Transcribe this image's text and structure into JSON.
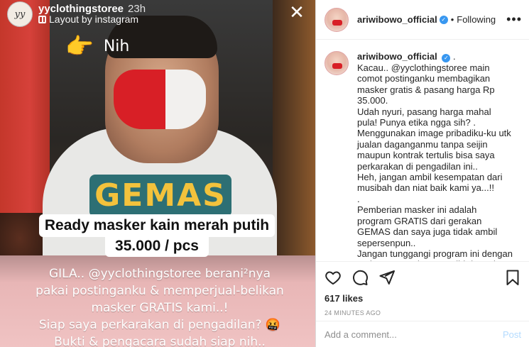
{
  "story": {
    "username": "yyclothingstoree",
    "time": "23h",
    "layout_label": "Layout by instagram",
    "avatar_text": "yy",
    "close_icon": "close-icon",
    "sticker_text": "Nih",
    "hand_glyph": "👉",
    "shirt_text": "GEMAS",
    "price_line1": "Ready masker kain merah putih",
    "price_line2": "35.000 / pcs",
    "caption_lines": [
      "GILA.. @yyclothingstoree berani²nya",
      "pakai postinganku & memperjual-belikan",
      "masker GRATIS kami..!",
      "Siap saya perkarakan di pengadilan? 🤬",
      "Bukti & pengacara sudah siap nih.."
    ]
  },
  "post": {
    "username": "ariwibowo_official",
    "follow_status": "Following",
    "separator": "•",
    "caption_username": "ariwibowo_official",
    "caption_dot": ".",
    "caption_paragraphs": [
      "Kacau.. @yyclothingstoree main comot postinganku membagikan masker gratis & pasang harga Rp 35.000.",
      "Udah nyuri, pasang harga mahal pula! Punya etika ngga sih? .",
      "Menggunakan image pribadiku-ku utk jualan daganganmu tanpa seijin maupun kontrak tertulis bisa saya perkarakan di pengadilan ini..",
      "Heh, jangan ambil kesempatan dari musibah dan niat baik kami ya...!!",
      ".",
      "Pemberian masker ini adalah program GRATIS dari gerakan GEMAS dan saya juga tidak ambil sepersenpun..",
      "Jangan tunggangi program ini dengan cari untung. Tolong tau diri dan minta maaf ke saya atau badan"
    ],
    "likes": "617 likes",
    "time_ago": "24 MINUTES AGO",
    "comment_placeholder": "Add a comment...",
    "post_label": "Post"
  },
  "colors": {
    "verified": "#3897f0",
    "post_button_disabled": "#b3dbff",
    "mask_red": "#d81f26"
  }
}
